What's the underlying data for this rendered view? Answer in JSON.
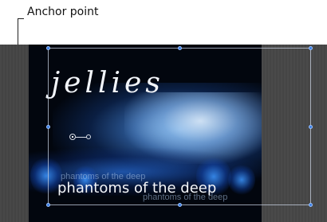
{
  "callout": {
    "label": "Anchor point"
  },
  "video": {
    "title": "jellies",
    "subtitle": "phantoms of the deep",
    "subtitle_echo_top": "phantoms of the deep",
    "subtitle_echo_bottom": "phantoms of the deep"
  },
  "canvas": {
    "background_color": "#444444",
    "selection_color": "#c8d2e1",
    "handle_color": "#3a7fe6"
  }
}
